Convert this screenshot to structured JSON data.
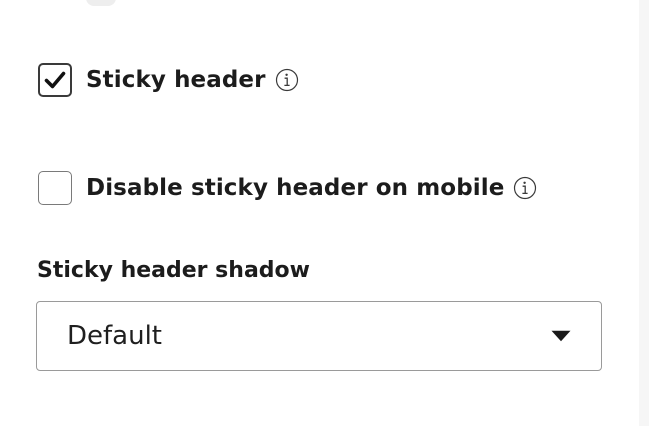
{
  "sticky_header": {
    "label": "Sticky header",
    "checked": true,
    "icons": {
      "checkbox": "checkmark-icon",
      "info": "info-icon"
    }
  },
  "disable_sticky_mobile": {
    "label": "Disable sticky header on mobile",
    "checked": false,
    "icons": {
      "info": "info-icon"
    }
  },
  "shadow": {
    "label": "Sticky header shadow",
    "selected": "Default",
    "icons": {
      "caret": "caret-down-icon"
    }
  },
  "colors": {
    "text": "#1c1c1c",
    "border": "#9a9a9a",
    "background": "#ffffff"
  }
}
